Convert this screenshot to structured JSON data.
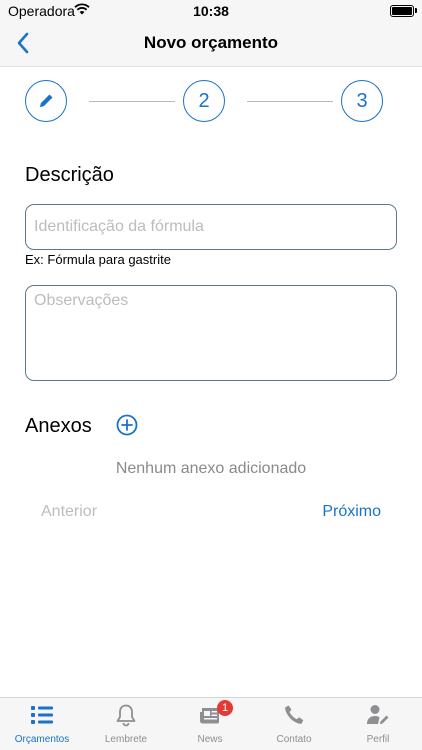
{
  "status_bar": {
    "carrier": "Operadora",
    "time": "10:38"
  },
  "nav": {
    "title": "Novo orçamento"
  },
  "stepper": {
    "step2": "2",
    "step3": "3"
  },
  "form": {
    "description_title": "Descrição",
    "identification_placeholder": "Identificação da fórmula",
    "identification_value": "",
    "hint": "Ex: Fórmula para gastrite",
    "observations_placeholder": "Observações",
    "observations_value": ""
  },
  "attachments": {
    "title": "Anexos",
    "empty_message": "Nenhum anexo adicionado"
  },
  "actions": {
    "previous_label": "Anterior",
    "next_label": "Próximo"
  },
  "tabs": [
    {
      "label": "Orçamentos",
      "icon": "list-icon",
      "active": true
    },
    {
      "label": "Lembrete",
      "icon": "bell-icon"
    },
    {
      "label": "News",
      "icon": "newspaper-icon",
      "badge": "1"
    },
    {
      "label": "Contato",
      "icon": "phone-icon"
    },
    {
      "label": "Perfil",
      "icon": "user-edit-icon"
    }
  ],
  "colors": {
    "accent": "#1a73c8",
    "badge": "#e53935",
    "bar_background": "#f6f6f6"
  }
}
